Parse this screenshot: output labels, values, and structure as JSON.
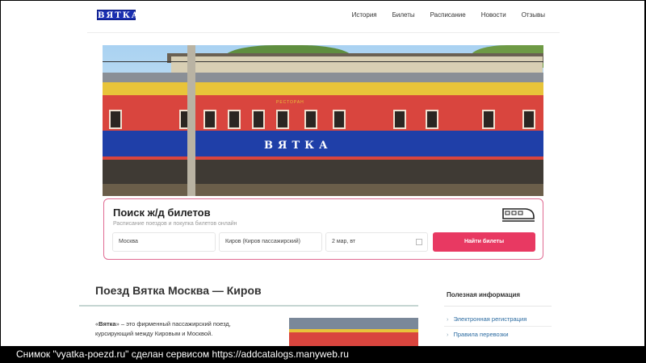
{
  "header": {
    "logo_text": "ВЯТКА",
    "nav": [
      "История",
      "Билеты",
      "Расписание",
      "Новости",
      "Отзывы"
    ]
  },
  "hero": {
    "train_name": "ВЯТКА",
    "car_label": "РЕСТОРАН"
  },
  "search": {
    "title": "Поиск ж/д билетов",
    "subtitle": "Расписание поездов и покупка билетов онлайн",
    "from_value": "Москва",
    "to_value": "Киров (Киров пассажирский)",
    "date_value": "2 мар, вт",
    "button_label": "Найти билеты"
  },
  "main": {
    "heading": "Поезд Вятка Москва — Киров",
    "intro_quote_open": "«",
    "intro_bold": "Вятка",
    "intro_rest": "» – это фирменный пассажирский поезд, курсирующий между Кировым и Москвой."
  },
  "sidebar": {
    "title": "Полезная информация",
    "items": [
      "Электронная регистрация",
      "Правила перевозки"
    ]
  },
  "footer": {
    "text": "Снимок \"vyatka-poezd.ru\" сделан сервисом https://addcatalogs.manyweb.ru"
  },
  "colors": {
    "accent": "#e83962",
    "logo_bg": "#1a2fb0",
    "link": "#2a6aa0"
  }
}
